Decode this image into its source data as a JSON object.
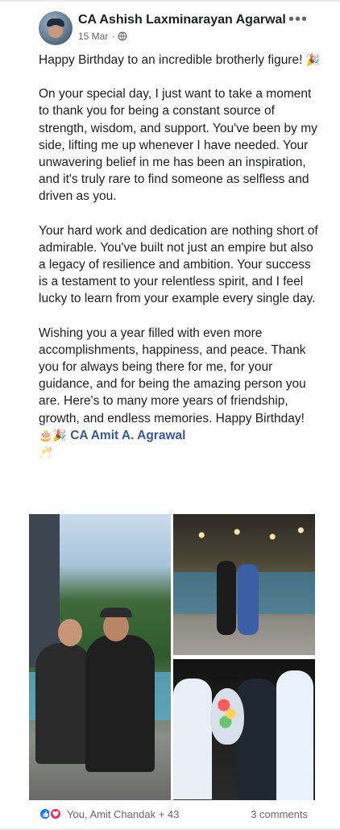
{
  "post": {
    "author": "CA Ashish Laxminarayan Agarwal",
    "date": "15 Mar",
    "separator": "·",
    "menu_glyph": "•••",
    "privacy_icon": "globe-icon",
    "paragraphs": [
      {
        "text": "Happy Birthday to an incredible brotherly figure! ",
        "emoji": "🎉"
      },
      {
        "text": "On your special day, I just want to take a moment to thank you for being a constant source of strength, wisdom, and support. You've been by my side, lifting me up whenever I have needed. Your unwavering belief in me has been an inspiration, and it's truly rare to find someone as selfless and driven as you."
      },
      {
        "text": "Your hard work and dedication are nothing short of admirable. You've built not just an empire but also a legacy of resilience and ambition. Your success is a testament to your relentless spirit, and I feel lucky to learn from your example every single day."
      },
      {
        "text": "Wishing you a year filled with even more accomplishments, happiness, and peace. Thank you for always being there for me, for your guidance, and for being the amazing person you are. Here's to many more years of friendship, growth, and endless memories. Happy Birthday! ",
        "emoji": "🎂🎉",
        "mention": "CA Amit A. Agrawal",
        "emoji_tail": "🥂"
      }
    ],
    "photos": [
      {
        "id": "photo-1",
        "description": "two men in black t-shirts seated by a pool"
      },
      {
        "id": "photo-2",
        "description": "two men standing by a poolside at night"
      },
      {
        "id": "photo-3",
        "description": "three men with a bouquet at an event"
      }
    ],
    "reactions": {
      "summary": "You, Amit Chandak + 43",
      "icons": [
        "like-icon",
        "love-icon"
      ]
    },
    "comments": "3 comments"
  },
  "colors": {
    "mention": "#385898",
    "meta": "#65676b",
    "like": "#1877f2",
    "love": "#f02849"
  }
}
